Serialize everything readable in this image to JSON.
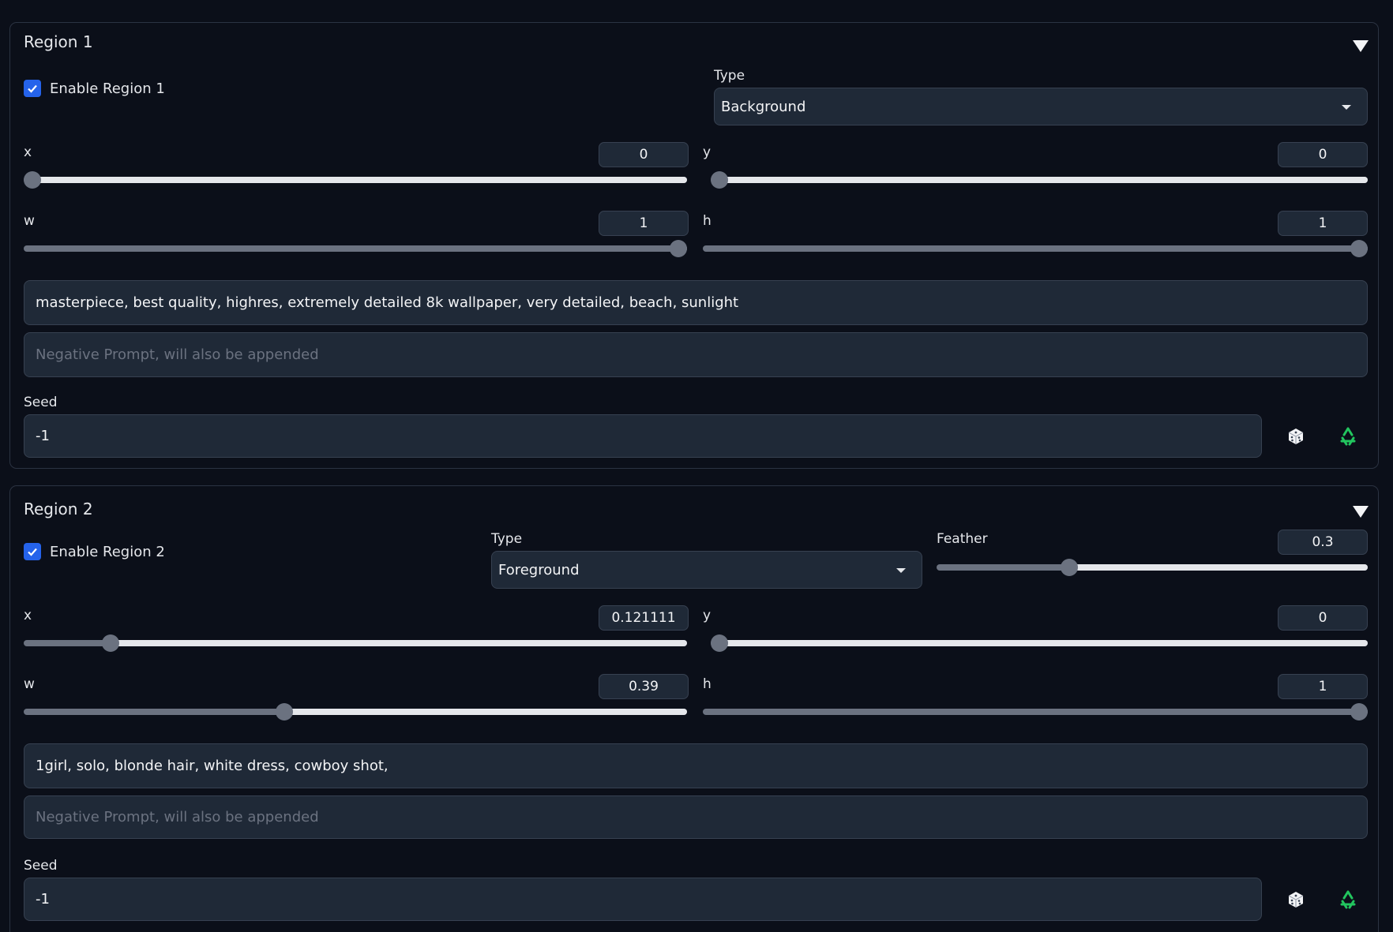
{
  "regions": [
    {
      "title": "Region 1",
      "enable_label": "Enable Region 1",
      "enabled": true,
      "type_label": "Type",
      "type_value": "Background",
      "x": {
        "label": "x",
        "value": "0",
        "fraction": 0
      },
      "y": {
        "label": "y",
        "value": "0",
        "fraction": 0
      },
      "w": {
        "label": "w",
        "value": "1",
        "fraction": 1
      },
      "h": {
        "label": "h",
        "value": "1",
        "fraction": 1
      },
      "prompt": "masterpiece, best quality, highres, extremely detailed 8k wallpaper, very detailed, beach, sunlight",
      "negative_placeholder": "Negative Prompt, will also be appended",
      "seed_label": "Seed",
      "seed_value": "-1"
    },
    {
      "title": "Region 2",
      "enable_label": "Enable Region 2",
      "enabled": true,
      "type_label": "Type",
      "type_value": "Foreground",
      "feather": {
        "label": "Feather",
        "value": "0.3",
        "fraction": 0.3
      },
      "x": {
        "label": "x",
        "value": "0.121111",
        "fraction": 0.121111
      },
      "y": {
        "label": "y",
        "value": "0",
        "fraction": 0
      },
      "w": {
        "label": "w",
        "value": "0.39",
        "fraction": 0.39
      },
      "h": {
        "label": "h",
        "value": "1",
        "fraction": 1
      },
      "prompt": "1girl, solo, blonde hair, white dress, cowboy shot,",
      "negative_placeholder": "Negative Prompt, will also be appended",
      "seed_label": "Seed",
      "seed_value": "-1"
    }
  ],
  "colors": {
    "accent": "#2563eb",
    "recycle": "#22c55e"
  },
  "icons": [
    "collapse-caret-icon",
    "checkmark-icon",
    "dropdown-caret-icon",
    "dice-icon",
    "recycle-icon"
  ]
}
